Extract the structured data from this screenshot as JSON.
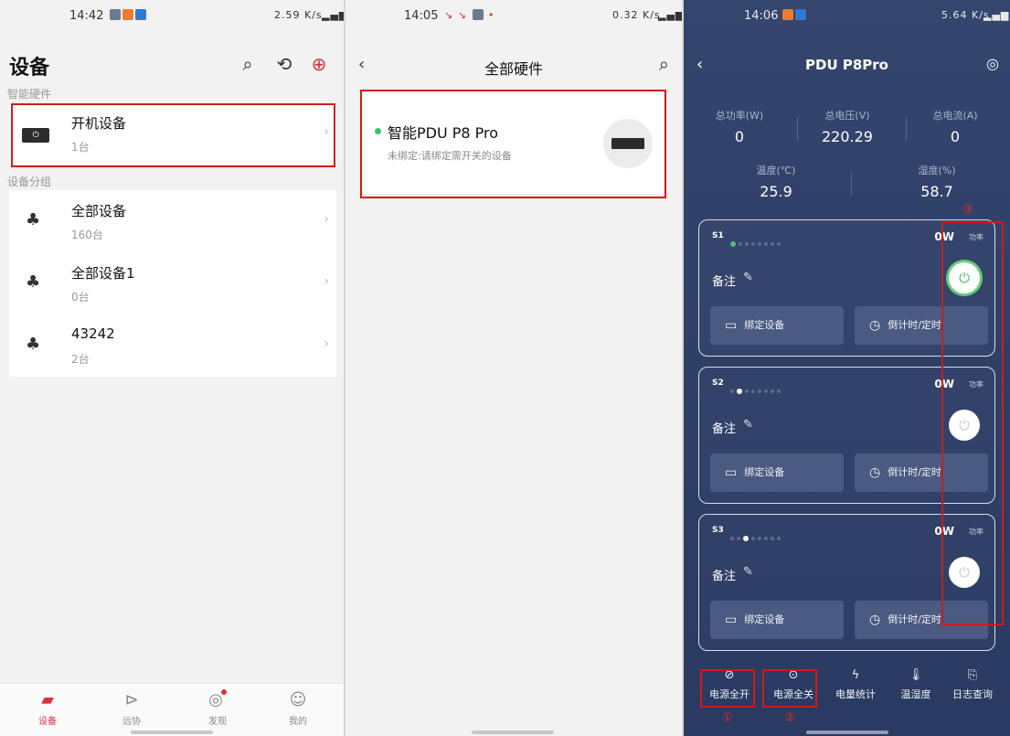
{
  "panel1": {
    "status": {
      "time": "14:42",
      "right": "2.59 K/s"
    },
    "title": "设备",
    "section_hardware": "智能硬件",
    "hardware_items": [
      {
        "name": "开机设备",
        "count": "1台"
      }
    ],
    "section_groups": "设备分组",
    "groups": [
      {
        "name": "全部设备",
        "count": "160台"
      },
      {
        "name": "全部设备1",
        "count": "0台"
      },
      {
        "name": "43242",
        "count": "2台"
      }
    ],
    "tabs": [
      {
        "label": "设备",
        "icon": "device-icon"
      },
      {
        "label": "远协",
        "icon": "send-icon"
      },
      {
        "label": "发现",
        "icon": "compass-icon"
      },
      {
        "label": "我的",
        "icon": "user-icon"
      }
    ]
  },
  "panel2": {
    "status": {
      "time": "14:05",
      "right": "0.32 K/s"
    },
    "title": "全部硬件",
    "device": {
      "name": "智能PDU P8 Pro",
      "subtitle": "未绑定:请绑定需开关的设备"
    }
  },
  "panel3": {
    "status": {
      "time": "14:06",
      "right": "5.64 K/s"
    },
    "title": "PDU P8Pro",
    "metrics": {
      "power_label": "总功率(W)",
      "power_value": "0",
      "voltage_label": "总电压(V)",
      "voltage_value": "220.29",
      "current_label": "总电流(A)",
      "current_value": "0",
      "temp_label": "温度(℃)",
      "temp_value": "25.9",
      "humidity_label": "湿度(%)",
      "humidity_value": "58.7"
    },
    "sockets": [
      {
        "id": "S1",
        "power": "0W",
        "power_unit": "功率",
        "memo": "备注",
        "bind": "绑定设备",
        "timer": "倒计时/定时",
        "on": true
      },
      {
        "id": "S2",
        "power": "0W",
        "power_unit": "功率",
        "memo": "备注",
        "bind": "绑定设备",
        "timer": "倒计时/定时",
        "on": false
      },
      {
        "id": "S3",
        "power": "0W",
        "power_unit": "功率",
        "memo": "备注",
        "bind": "绑定设备",
        "timer": "倒计时/定时",
        "on": false
      }
    ],
    "bottom_actions": [
      {
        "label": "电源全开",
        "icon": "power-on-icon"
      },
      {
        "label": "电源全关",
        "icon": "power-off-icon"
      },
      {
        "label": "电量统计",
        "icon": "lightning-icon"
      },
      {
        "label": "温湿度",
        "icon": "thermometer-icon"
      },
      {
        "label": "日志查询",
        "icon": "log-icon"
      }
    ],
    "annotations": [
      "①",
      "②",
      "③"
    ]
  },
  "colors": {
    "accent_red": "#d11a1a",
    "pdu_bg": "#2f4068",
    "online_green": "#3cc46b"
  }
}
